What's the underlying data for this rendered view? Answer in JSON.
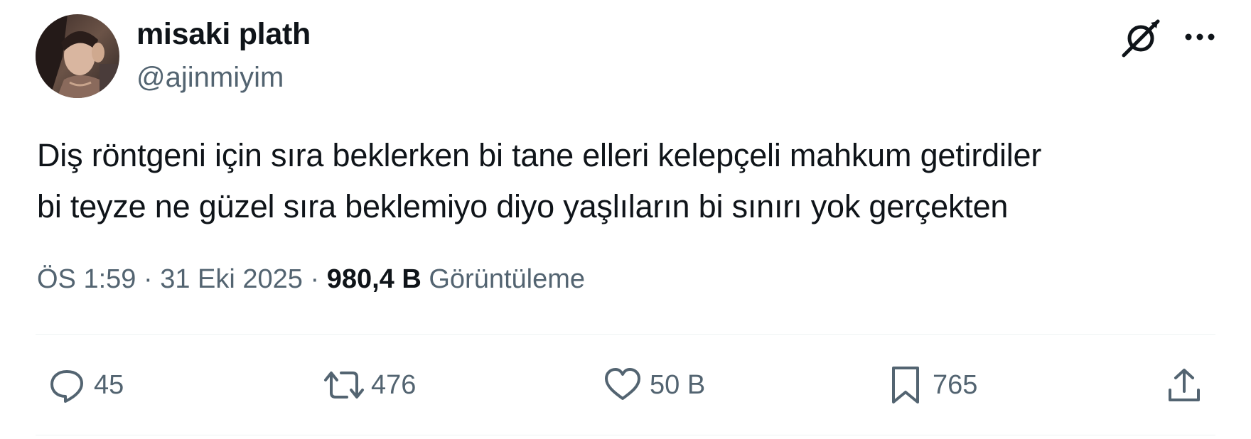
{
  "author": {
    "display_name": "misaki plath",
    "handle": "@ajinmiyim"
  },
  "tweet": {
    "text_lines": [
      "Diş röntgeni için sıra beklerken bi tane elleri kelepçeli mahkum getirdiler",
      "bi teyze ne güzel sıra beklemiyo diyo yaşlıların bi sınırı yok gerçekten"
    ]
  },
  "meta": {
    "time": "ÖS 1:59",
    "separator": "·",
    "date": "31 Eki 2025",
    "views_count": "980,4 B",
    "views_label": "Görüntüleme"
  },
  "actions": {
    "reply_count": "45",
    "retweet_count": "476",
    "like_count": "50 B",
    "bookmark_count": "765"
  },
  "icons": {
    "grok": "grok-icon",
    "more": "more-icon",
    "reply": "reply-icon",
    "retweet": "retweet-icon",
    "like": "heart-icon",
    "bookmark": "bookmark-icon",
    "share": "share-icon"
  },
  "colors": {
    "text_primary": "#0f1419",
    "text_secondary": "#536471",
    "divider": "#eff3f4"
  }
}
